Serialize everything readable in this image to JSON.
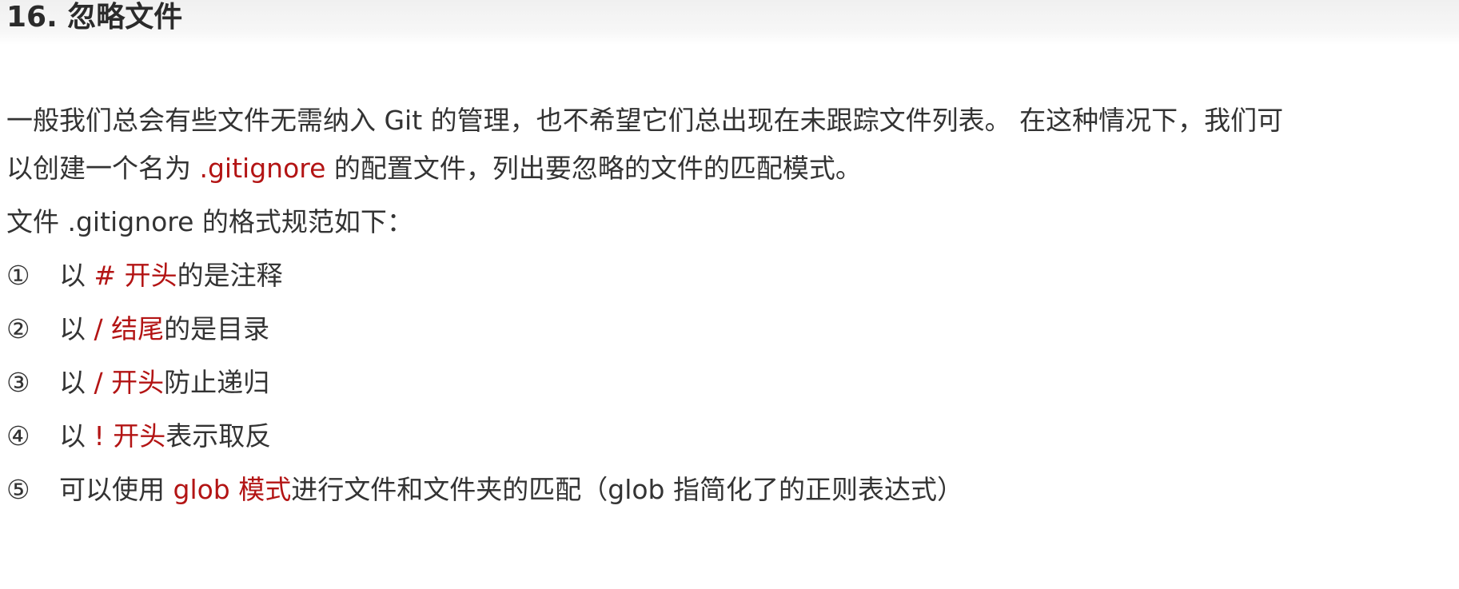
{
  "section": {
    "heading": "16. 忽略文件"
  },
  "intro": {
    "line1": "一般我们总会有些文件无需纳入 Git 的管理，也不希望它们总出现在未跟踪文件列表。 在这种情况下，我们可",
    "line2_prefix": "以创建一个名为 ",
    "line2_accent": ".gitignore",
    "line2_suffix": " 的配置文件，列出要忽略的文件的匹配模式。"
  },
  "format_intro": "文件 .gitignore 的格式规范如下：",
  "rules": [
    {
      "num": "①",
      "prefix": "以 ",
      "accent": "# 开头",
      "suffix": "的是注释"
    },
    {
      "num": "②",
      "prefix": "以 ",
      "accent": "/ 结尾",
      "suffix": "的是目录"
    },
    {
      "num": "③",
      "prefix": "以 ",
      "accent": "/ 开头",
      "suffix": "防止递归"
    },
    {
      "num": "④",
      "prefix": "以 ",
      "accent": "! 开头",
      "suffix": "表示取反"
    },
    {
      "num": "⑤",
      "prefix": "可以使用 ",
      "accent": "glob 模式",
      "suffix": "进行文件和文件夹的匹配（glob 指简化了的正则表达式）"
    }
  ],
  "colors": {
    "accent": "#b31414",
    "text": "#333333"
  }
}
